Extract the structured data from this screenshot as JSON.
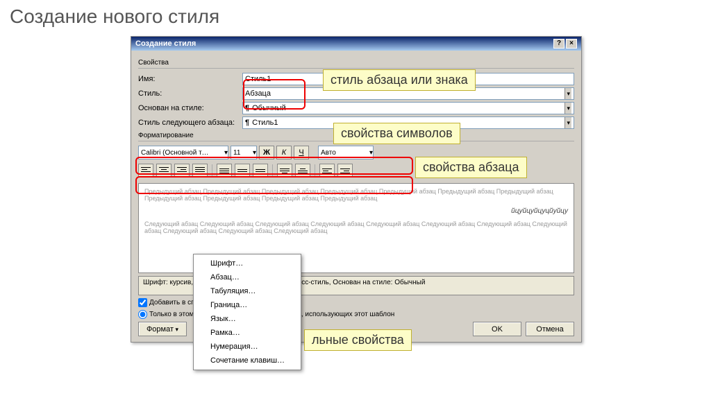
{
  "page_title": "Создание нового стиля",
  "dialog": {
    "title": "Создание стиля",
    "groups": {
      "properties": "Свойства",
      "formatting": "Форматирование"
    },
    "props": {
      "name_label": "Имя:",
      "name_value": "Стиль1",
      "style_label": "Стиль:",
      "style_value": "Абзаца",
      "based_label": "Основан на стиле:",
      "based_value": "Обычный",
      "next_label": "Стиль следующего абзаца:",
      "next_value": "Стиль1"
    },
    "format": {
      "font": "Calibri (Основной текст)",
      "size": "11",
      "bold": "Ж",
      "italic": "К",
      "underline": "Ч",
      "color": "Авто"
    },
    "preview": {
      "prev_para": "Предыдущий абзац Предыдущий абзац Предыдущий абзац Предыдущий абзац Предыдущий абзац Предыдущий абзац Предыдущий абзац Предыдущий абзац Предыдущий абзац Предыдущий абзац Предыдущий абзац",
      "sample": "йцуйцуйцуцйуйцу",
      "next_para": "Следующий абзац Следующий абзац Следующий абзац Следующий абзац Следующий абзац Следующий абзац Следующий абзац Следующий абзац Следующий абзац Следующий абзац Следующий абзац"
    },
    "description": "Шрифт: курсив, По правому краю, Стиль: Экспресс-стиль, Основан на стиле: Обычный",
    "checks": {
      "add": "Добавить в список экспресс-стилей",
      "template": "Только в этом документе / В новых документах, использующих этот шаблон"
    },
    "buttons": {
      "format": "Формат",
      "ok": "OK",
      "cancel": "Отмена"
    }
  },
  "menu": {
    "items": [
      "Шрифт…",
      "Абзац…",
      "Табуляция…",
      "Граница…",
      "Язык…",
      "Рамка…",
      "Нумерация…",
      "Сочетание клавиш…"
    ]
  },
  "callouts": {
    "c1": "стиль абзаца или знака",
    "c2": "свойства символов",
    "c3": "свойства абзаца",
    "c4": "льные свойства"
  }
}
